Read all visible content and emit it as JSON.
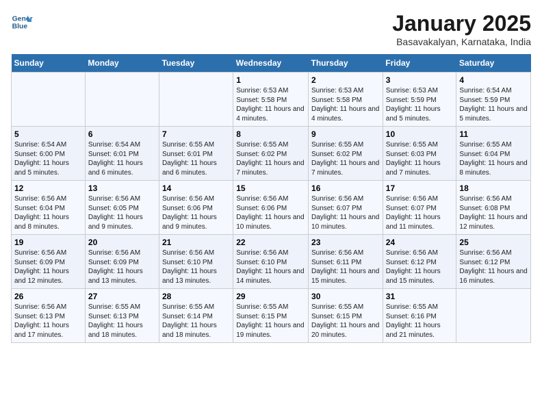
{
  "header": {
    "logo_line1": "General",
    "logo_line2": "Blue",
    "title": "January 2025",
    "subtitle": "Basavakalyan, Karnataka, India"
  },
  "weekdays": [
    "Sunday",
    "Monday",
    "Tuesday",
    "Wednesday",
    "Thursday",
    "Friday",
    "Saturday"
  ],
  "weeks": [
    [
      {
        "day": "",
        "info": ""
      },
      {
        "day": "",
        "info": ""
      },
      {
        "day": "",
        "info": ""
      },
      {
        "day": "1",
        "info": "Sunrise: 6:53 AM\nSunset: 5:58 PM\nDaylight: 11 hours and 4 minutes."
      },
      {
        "day": "2",
        "info": "Sunrise: 6:53 AM\nSunset: 5:58 PM\nDaylight: 11 hours and 4 minutes."
      },
      {
        "day": "3",
        "info": "Sunrise: 6:53 AM\nSunset: 5:59 PM\nDaylight: 11 hours and 5 minutes."
      },
      {
        "day": "4",
        "info": "Sunrise: 6:54 AM\nSunset: 5:59 PM\nDaylight: 11 hours and 5 minutes."
      }
    ],
    [
      {
        "day": "5",
        "info": "Sunrise: 6:54 AM\nSunset: 6:00 PM\nDaylight: 11 hours and 5 minutes."
      },
      {
        "day": "6",
        "info": "Sunrise: 6:54 AM\nSunset: 6:01 PM\nDaylight: 11 hours and 6 minutes."
      },
      {
        "day": "7",
        "info": "Sunrise: 6:55 AM\nSunset: 6:01 PM\nDaylight: 11 hours and 6 minutes."
      },
      {
        "day": "8",
        "info": "Sunrise: 6:55 AM\nSunset: 6:02 PM\nDaylight: 11 hours and 7 minutes."
      },
      {
        "day": "9",
        "info": "Sunrise: 6:55 AM\nSunset: 6:02 PM\nDaylight: 11 hours and 7 minutes."
      },
      {
        "day": "10",
        "info": "Sunrise: 6:55 AM\nSunset: 6:03 PM\nDaylight: 11 hours and 7 minutes."
      },
      {
        "day": "11",
        "info": "Sunrise: 6:55 AM\nSunset: 6:04 PM\nDaylight: 11 hours and 8 minutes."
      }
    ],
    [
      {
        "day": "12",
        "info": "Sunrise: 6:56 AM\nSunset: 6:04 PM\nDaylight: 11 hours and 8 minutes."
      },
      {
        "day": "13",
        "info": "Sunrise: 6:56 AM\nSunset: 6:05 PM\nDaylight: 11 hours and 9 minutes."
      },
      {
        "day": "14",
        "info": "Sunrise: 6:56 AM\nSunset: 6:06 PM\nDaylight: 11 hours and 9 minutes."
      },
      {
        "day": "15",
        "info": "Sunrise: 6:56 AM\nSunset: 6:06 PM\nDaylight: 11 hours and 10 minutes."
      },
      {
        "day": "16",
        "info": "Sunrise: 6:56 AM\nSunset: 6:07 PM\nDaylight: 11 hours and 10 minutes."
      },
      {
        "day": "17",
        "info": "Sunrise: 6:56 AM\nSunset: 6:07 PM\nDaylight: 11 hours and 11 minutes."
      },
      {
        "day": "18",
        "info": "Sunrise: 6:56 AM\nSunset: 6:08 PM\nDaylight: 11 hours and 12 minutes."
      }
    ],
    [
      {
        "day": "19",
        "info": "Sunrise: 6:56 AM\nSunset: 6:09 PM\nDaylight: 11 hours and 12 minutes."
      },
      {
        "day": "20",
        "info": "Sunrise: 6:56 AM\nSunset: 6:09 PM\nDaylight: 11 hours and 13 minutes."
      },
      {
        "day": "21",
        "info": "Sunrise: 6:56 AM\nSunset: 6:10 PM\nDaylight: 11 hours and 13 minutes."
      },
      {
        "day": "22",
        "info": "Sunrise: 6:56 AM\nSunset: 6:10 PM\nDaylight: 11 hours and 14 minutes."
      },
      {
        "day": "23",
        "info": "Sunrise: 6:56 AM\nSunset: 6:11 PM\nDaylight: 11 hours and 15 minutes."
      },
      {
        "day": "24",
        "info": "Sunrise: 6:56 AM\nSunset: 6:12 PM\nDaylight: 11 hours and 15 minutes."
      },
      {
        "day": "25",
        "info": "Sunrise: 6:56 AM\nSunset: 6:12 PM\nDaylight: 11 hours and 16 minutes."
      }
    ],
    [
      {
        "day": "26",
        "info": "Sunrise: 6:56 AM\nSunset: 6:13 PM\nDaylight: 11 hours and 17 minutes."
      },
      {
        "day": "27",
        "info": "Sunrise: 6:55 AM\nSunset: 6:13 PM\nDaylight: 11 hours and 18 minutes."
      },
      {
        "day": "28",
        "info": "Sunrise: 6:55 AM\nSunset: 6:14 PM\nDaylight: 11 hours and 18 minutes."
      },
      {
        "day": "29",
        "info": "Sunrise: 6:55 AM\nSunset: 6:15 PM\nDaylight: 11 hours and 19 minutes."
      },
      {
        "day": "30",
        "info": "Sunrise: 6:55 AM\nSunset: 6:15 PM\nDaylight: 11 hours and 20 minutes."
      },
      {
        "day": "31",
        "info": "Sunrise: 6:55 AM\nSunset: 6:16 PM\nDaylight: 11 hours and 21 minutes."
      },
      {
        "day": "",
        "info": ""
      }
    ]
  ]
}
